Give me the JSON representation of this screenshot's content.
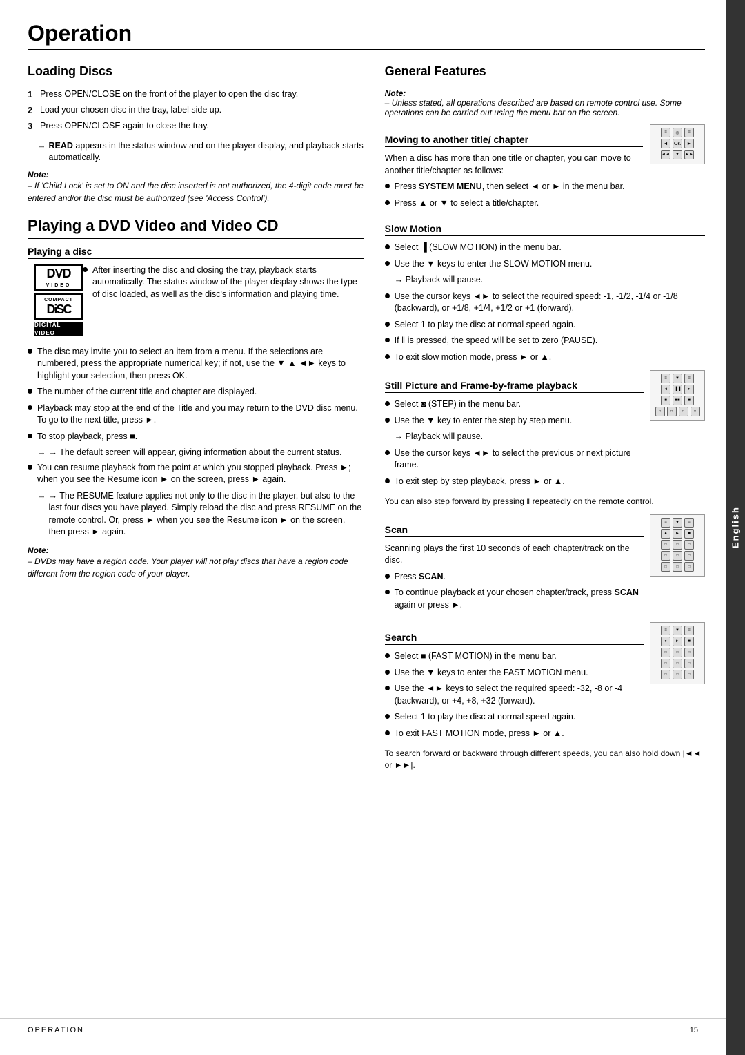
{
  "page": {
    "title": "Operation",
    "footer_left": "Operation",
    "footer_page": "15",
    "side_tab": "English"
  },
  "left_col": {
    "loading_discs": {
      "title": "Loading Discs",
      "steps": [
        "Press OPEN/CLOSE on the front of the player to open the disc tray.",
        "Load your chosen disc in the tray, label side up.",
        "Press OPEN/CLOSE again to close the tray."
      ],
      "arrow1": "→ READ appears in the status window and on the player display, and playback starts automatically.",
      "note_title": "Note:",
      "note_body": "– If 'Child Lock' is set to ON and the disc inserted is not authorized, the 4-digit code must be entered and/or the disc must be authorized (see 'Access Control')."
    },
    "playing_dvd": {
      "title": "Playing a DVD Video and Video CD",
      "playing_disc_title": "Playing a disc",
      "bullets": [
        "After inserting the disc and closing the tray, playback starts automatically. The status window of the player display shows the type of disc loaded, as well as the disc's information and playing time.",
        "The disc may invite you to select an item from a menu. If the selections are numbered, press the appropriate numerical key; if not, use the ▼ ▲ ◄► keys to highlight your selection, then press OK.",
        "The number of the current title and chapter are displayed.",
        "Playback may stop at the end of the Title and you may return to the DVD disc menu. To go to the next title, press ►.",
        "To stop playback, press ■."
      ],
      "arrow2": "→ The default screen will appear, giving information about the current status.",
      "bullet6": "You can resume playback from the point at which you stopped playback. Press ►; when you see the Resume icon ► on the screen, press ► again.",
      "arrow3": "→ The RESUME feature applies not only to the disc in the player, but also to the last four discs you have played. Simply reload the disc and press RESUME on the remote control. Or, press ► when you see the Resume icon ► on the screen, then press ► again.",
      "note2_title": "Note:",
      "note2_body": "– DVDs may have a region code. Your player will not play discs that have a region code different from the region code of your player."
    }
  },
  "right_col": {
    "general_features": {
      "title": "General Features",
      "note_label": "Note:",
      "note_body": "– Unless stated, all operations described are based on remote control use.  Some operations can be carried out using the menu bar on the screen."
    },
    "moving_title": {
      "title": "Moving to another title/ chapter",
      "intro": "When a disc has more than one title or chapter, you can move to another title/chapter as follows:",
      "bullets": [
        "Press SYSTEM MENU, then select ◄ or ► in the menu bar.",
        "Press ▲ or ▼ to select a title/chapter."
      ]
    },
    "slow_motion": {
      "title": "Slow Motion",
      "bullets": [
        "Select ▐ (SLOW MOTION) in the menu bar.",
        "Use the ▼ keys to enter the SLOW MOTION menu.",
        "→ Playback will pause.",
        "Use the cursor keys ◄► to select the required speed: -1, -1/2, -1/4 or -1/8 (backward), or +1/8, +1/4, +1/2 or +1 (forward).",
        "Select 1 to play the disc at normal speed again.",
        "If ‖ is pressed, the speed will be set to zero (PAUSE).",
        "To exit slow motion mode, press ► or ▲."
      ]
    },
    "still_picture": {
      "title": "Still Picture and Frame-by-frame playback",
      "bullets": [
        "Select ◙ (STEP) in the menu bar.",
        "Use the ▼ key to enter the step by step menu.",
        "→ Playback will pause.",
        "Use the cursor keys ◄► to select the previous or next picture frame.",
        "To exit step by step playback, press ► or ▲."
      ],
      "extra": "You can also step forward by pressing ‖ repeatedly on the remote control."
    },
    "scan": {
      "title": "Scan",
      "intro": "Scanning plays the first 10 seconds of each chapter/track on the disc.",
      "bullets": [
        "Press SCAN.",
        "To continue playback at your chosen chapter/track, press SCAN again or press ►."
      ]
    },
    "search": {
      "title": "Search",
      "bullets": [
        "Select ■ (FAST MOTION) in the menu bar.",
        "Use the ▼ keys to enter the FAST MOTION menu.",
        "Use the ◄► keys to select the required speed: -32, -8 or -4 (backward), or +4, +8, +32 (forward).",
        "Select 1 to play the disc at normal speed again.",
        "To exit FAST MOTION mode, press ► or ▲."
      ],
      "extra": "To search forward or backward through different speeds, you can also hold down |◄◄ or ►►|."
    }
  }
}
